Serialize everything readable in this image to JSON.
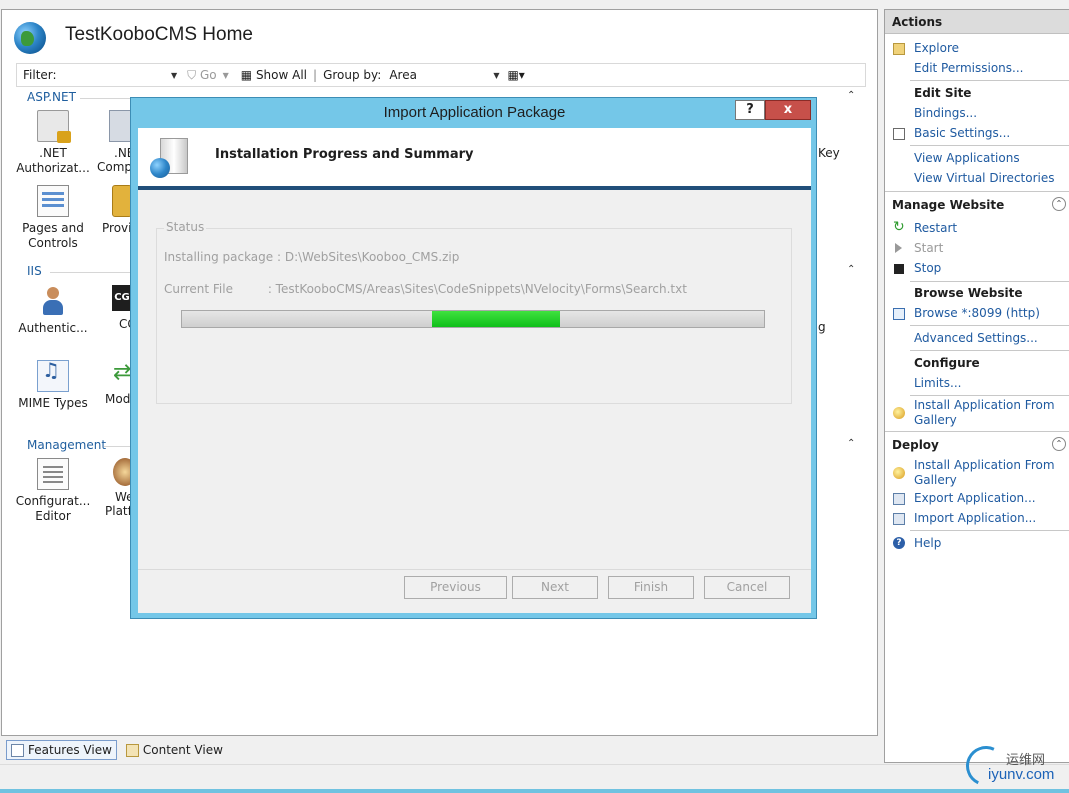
{
  "page": {
    "title": "TestKooboCMS Home",
    "filter_label": "Filter:",
    "go_label": "Go",
    "show_all_label": "Show All",
    "group_by_label": "Group by:",
    "group_by_value": "Area"
  },
  "groups": [
    {
      "name": "ASP.NET"
    },
    {
      "name": "IIS"
    },
    {
      "name": "Management"
    }
  ],
  "features": {
    "net_auth": ".NET\nAuthorizat...",
    "net_auth_l1": ".NET",
    "net_auth_l2": "Authorizat...",
    "net_comp_l1": ".NE",
    "net_comp_l2": "Compi",
    "pages_l1": "Pages and",
    "pages_l2": "Controls",
    "providers": "Provi",
    "machine_key": "Key",
    "authentication": "Authentic...",
    "cgi": "CG",
    "logging_tail": "g",
    "mime": "MIME Types",
    "modules": "Mod",
    "config_l1": "Configurat...",
    "config_l2": "Editor",
    "web_l1": "We",
    "web_l2": "Platf"
  },
  "bottom_tabs": {
    "features_view": "Features View",
    "content_view": "Content View"
  },
  "actions": {
    "header": "Actions",
    "explore": "Explore",
    "edit_permissions": "Edit Permissions...",
    "edit_site": "Edit Site",
    "bindings": "Bindings...",
    "basic_settings": "Basic Settings...",
    "view_applications": "View Applications",
    "view_virtual_directories": "View Virtual Directories",
    "manage_website": "Manage Website",
    "restart": "Restart",
    "start": "Start",
    "stop": "Stop",
    "browse_website": "Browse Website",
    "browse_link": "Browse *:8099 (http)",
    "advanced_settings": "Advanced Settings...",
    "configure": "Configure",
    "limits": "Limits...",
    "install_gallery_1": "Install Application From Gallery",
    "deploy": "Deploy",
    "install_gallery_2": "Install Application From Gallery",
    "export_app": "Export Application...",
    "import_app": "Import Application...",
    "help": "Help"
  },
  "dialog": {
    "title": "Import Application Package",
    "help_btn": "?",
    "close_btn": "x",
    "header": "Installation Progress and Summary",
    "status_label": "Status",
    "installing_key": "Installing package :",
    "installing_val": "D:\\WebSites\\Kooboo_CMS.zip",
    "current_file_key": "Current File",
    "current_file_val": ": TestKooboCMS/Areas\\Sites\\CodeSnippets\\NVelocity\\Forms\\Search.txt",
    "progress_segment_start": 0.43,
    "progress_segment_end": 0.65,
    "buttons": {
      "previous": "Previous",
      "next": "Next",
      "finish": "Finish",
      "cancel": "Cancel"
    }
  },
  "watermark": {
    "cn": "运维网",
    "en": "iyunv.com"
  },
  "colors": {
    "link": "#1f5aa0",
    "dialog_frame": "#74c7e8",
    "close_red": "#c7504a",
    "progress_green": "#0fbf1a"
  }
}
